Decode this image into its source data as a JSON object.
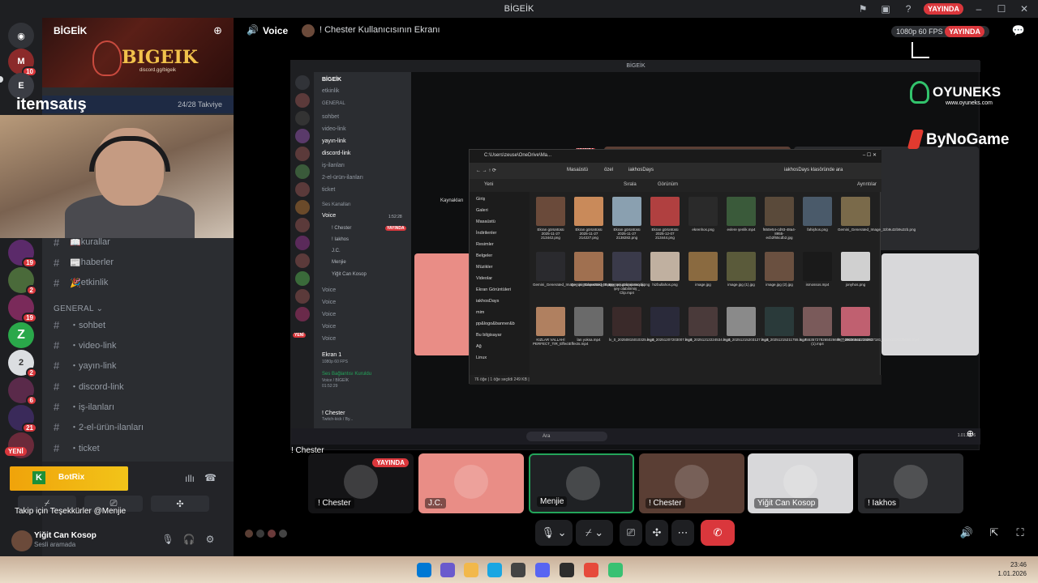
{
  "window": {
    "title": "BİGEİK",
    "live_badge": "YAYINDA"
  },
  "rail": {
    "badges": [
      "10",
      "19",
      "2",
      "19",
      "2",
      "6",
      "21"
    ],
    "new_label": "YENİ"
  },
  "sidebar": {
    "server_name": "BİGEİK",
    "banner_logo": "BIGEIK",
    "banner_sub": "discord.gg/bigeik",
    "sponsor": "itemsatış",
    "boost": "24/28 Takviye",
    "channels_top": [
      {
        "icon": "📖",
        "label": "kurallar"
      },
      {
        "icon": "📰",
        "label": "haberler"
      },
      {
        "icon": "🎉",
        "label": "etkinlik"
      }
    ],
    "section_general": "GENERAL",
    "channels_general": [
      "・sohbet",
      "・video-link",
      "・yayın-link",
      "・discord-link",
      "・iş-ilanları",
      "・2-el-ürün-ilanları",
      "・ticket"
    ],
    "voice_panel": {
      "bot": "BotRix",
      "bot_letter": "K",
      "message": "Takip için Teşekkürler @Menjie"
    },
    "user": {
      "name": "Yiğit Can Kosop",
      "status": "Sesli aramada"
    }
  },
  "header": {
    "channel": "Voice",
    "screen_title": "! Chester Kullanıcısının Ekranı",
    "quality": "1080p 60 FPS",
    "live": "YAYINDA"
  },
  "stream": {
    "inner_title": "BİGEİK",
    "inner_server": "BİGEİK",
    "inner_channels": [
      "etkinlik",
      "GENERAL",
      "sohbet",
      "video-link",
      "yayın-link",
      "discord-link",
      "iş-ilanları",
      "2-el-ürün-ilanları",
      "ticket",
      "Ses Kanalları",
      "Voice"
    ],
    "inner_voice_time": "1:52:28",
    "inner_members": [
      "! Chester",
      "! Iakhos",
      "J.C.",
      "Menjie",
      "Yiğit Can Kosop"
    ],
    "inner_voice_channels": [
      "Voice",
      "Voice",
      "Voice",
      "Voice",
      "Voice"
    ],
    "inner_screen": "Ekran 1",
    "inner_screen_sub": "1080p 60 FPS",
    "inner_connected": "Ses Bağlantısı Kuruldu",
    "inner_connected_sub": "Voice / BİGEİK",
    "inner_connected_time": "01:52:29",
    "inner_user": "! Chester",
    "inner_user_sub": "Twitch-kick / By...",
    "inner_new": "YENİ",
    "inner_live": "YAYINDA",
    "inner_label_left": "Kaynakları",
    "explorer": {
      "tab": "C:\\Users\\zeuse\\OneDrive\\Ma...",
      "path": [
        "Masaüstü",
        "özel",
        "iakhosDays"
      ],
      "search": "iakhosDays klasöründe ara",
      "toolbar": [
        "Yeni",
        "Sırala",
        "Görünüm",
        "Ayrıntılar"
      ],
      "nav": [
        "Giriş",
        "Galeri",
        "Masaüstü",
        "İndirilenler",
        "Resimler",
        "Belgeler",
        "Müzikler",
        "Videolar",
        "Ekran Görüntüleri",
        "iakhosDays",
        "mim",
        "pp&logo&banner&b",
        "Bu bilgisayar",
        "Ağ",
        "Linux"
      ],
      "files": [
        "Ekran görüntüsü 2025-11-27 213442.png",
        "Ekran görüntüsü 2025-11-27 214227.png",
        "Ekran görüntüsü 2025-11-27 2138282.png",
        "Ekran görüntüsü 2025-12-07 213444.png",
        "ekrenhos.png",
        "evlere şenlik.mp4",
        "f650e54-cd93-48a4-8955-ecb2f65cdb2.jpg",
        "fahişhos.png",
        "Gemini_Generated_Image_3zb9u3zb9u3zb.png",
        "Gemini_Generated_Image_qn48olqn48oky48.png",
        "Gemini_Generated_Image_qoju4aqoju4aqoj.png",
        "Hemen gelmezsen bir şey olabilirmiş _ Clip.mp4",
        "hizbullahos.png",
        "image.jpg",
        "image.jpg (1).jpg",
        "image.jpg (2).jpg",
        "ismossos.mp4",
        "jonyhos.png",
        "KIZLAR VALLAHİ PERFECT_TIR_EffectEffects.mp4",
        "lan yoksa.mp4",
        "lv_0_20250815010325.mp4",
        "lv_0_20251207203007.mp4",
        "lv_0_20251212224534.mp4",
        "lv_0_20251215203127.mp4",
        "lv_0_20251215211755.mp4",
        "lv_7553572782650266897_20251124235051 (1).mp4",
        "lv_7496369622332837181_20251124235058.mp4"
      ],
      "status": "76 öğe  |  1 öğe seçildi 249 KB  |"
    },
    "win_search": "Ara",
    "win_date": "1.01.2026",
    "stream_owner": "! Chester"
  },
  "sponsors": {
    "oyuneks": "OYUNEKS",
    "oyuneks_url": "www.oyuneks.com",
    "bynogame": "ByNoGame"
  },
  "participants": [
    {
      "name": "! Chester",
      "tag": "YAYINDA",
      "color": "#141416"
    },
    {
      "name": "J.C.",
      "tag": "",
      "color": "#e98d86"
    },
    {
      "name": "Menjie",
      "tag": "",
      "color": "#1f2124"
    },
    {
      "name": "! Chester",
      "tag": "",
      "color": "#5a3e34"
    },
    {
      "name": "Yiğit Can Kosop",
      "tag": "",
      "color": "#d8d8da"
    },
    {
      "name": "! Iakhos",
      "tag": "",
      "color": "#2a2b2e"
    }
  ],
  "taskbar": {
    "time": "23:46",
    "date": "1.01.2026"
  }
}
